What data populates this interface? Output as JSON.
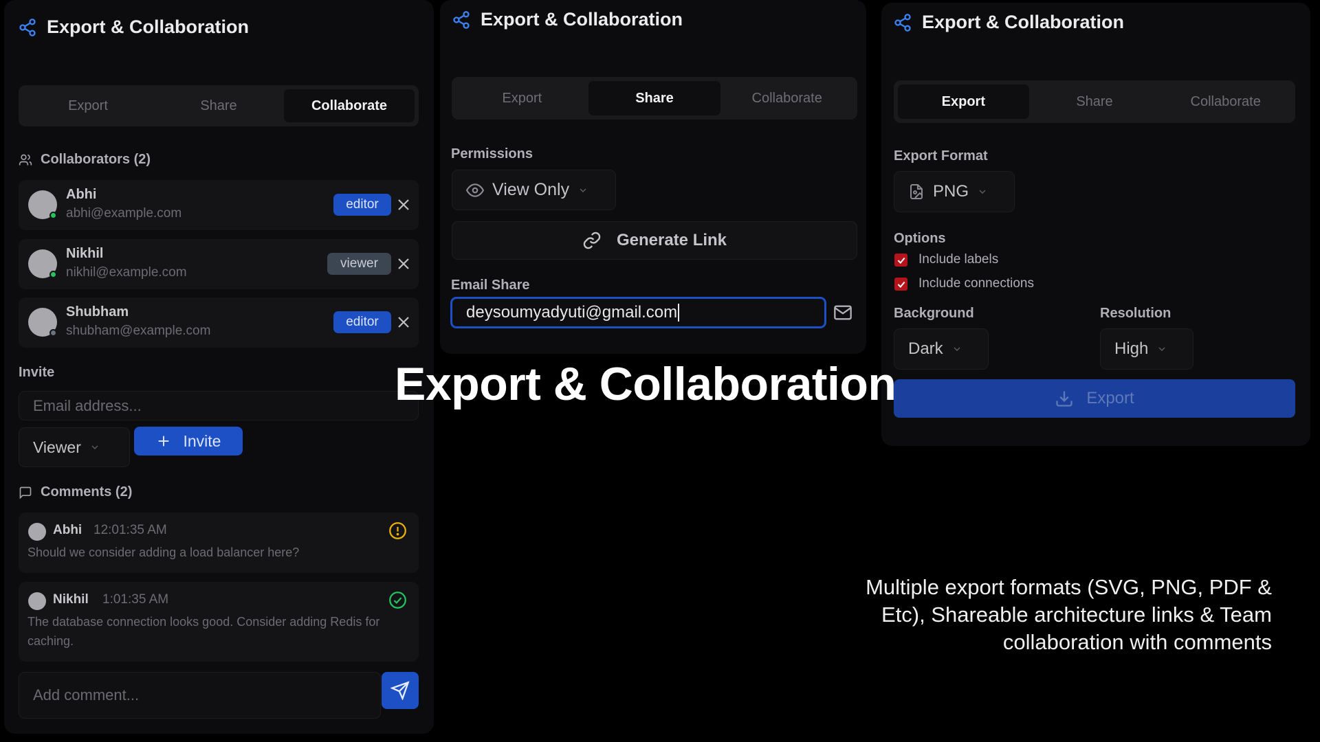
{
  "collaborate_panel": {
    "title": "Export & Collaboration",
    "tabs": [
      "Export",
      "Share",
      "Collaborate"
    ],
    "active_tab": "Collaborate",
    "collaborators_label": "Collaborators (2)",
    "collaborators": [
      {
        "name": "Abhi",
        "email": "abhi@example.com",
        "role": "editor",
        "status_color": "#22c55e"
      },
      {
        "name": "Nikhil",
        "email": "nikhil@example.com",
        "role": "viewer",
        "status_color": "#22c55e"
      },
      {
        "name": "Shubham",
        "email": "shubham@example.com",
        "role": "editor",
        "status_color": "#6b7280"
      }
    ],
    "invite_label": "Invite",
    "invite_placeholder": "Email address...",
    "invite_role": "Viewer",
    "invite_button": "Invite",
    "comments_label": "Comments (2)",
    "comments": [
      {
        "author": "Abhi",
        "time": "12:01:35 AM",
        "text": "Should we consider adding a load balancer here?",
        "status_icon": "alert-circle-icon",
        "status_color": "#eab308"
      },
      {
        "author": "Nikhil",
        "time": "1:01:35 AM",
        "text": "The database connection looks good. Consider adding Redis for caching.",
        "status_icon": "check-circle-icon",
        "status_color": "#22c55e"
      }
    ],
    "comment_placeholder": "Add comment..."
  },
  "share_panel": {
    "title": "Export & Collaboration",
    "tabs": [
      "Export",
      "Share",
      "Collaborate"
    ],
    "active_tab": "Share",
    "permissions_label": "Permissions",
    "permission_value": "View Only",
    "generate_link_label": "Generate Link",
    "email_share_label": "Email Share",
    "email_value": "deysoumyadyuti@gmail.com"
  },
  "export_panel": {
    "title": "Export & Collaboration",
    "tabs": [
      "Export",
      "Share",
      "Collaborate"
    ],
    "active_tab": "Export",
    "format_label": "Export Format",
    "format_value": "PNG",
    "options_label": "Options",
    "options": [
      {
        "label": "Include labels",
        "checked": true
      },
      {
        "label": "Include connections",
        "checked": true
      }
    ],
    "background_label": "Background",
    "background_value": "Dark",
    "resolution_label": "Resolution",
    "resolution_value": "High",
    "export_button": "Export"
  },
  "overlay": {
    "heading": "Export & Collaboration",
    "description": "Multiple export formats (SVG, PNG, PDF & Etc), Shareable architecture links & Team collaboration with comments"
  },
  "colors": {
    "accent_blue": "#1d4fc5",
    "checkbox_red": "#b5141c",
    "icon_blue": "#3b82f6"
  }
}
